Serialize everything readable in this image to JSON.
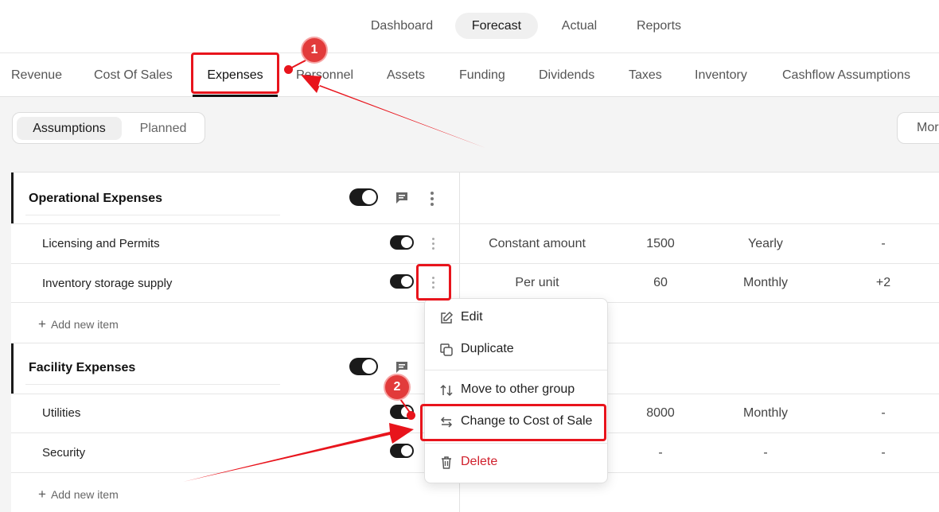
{
  "topnav": {
    "items": [
      {
        "label": "Dashboard"
      },
      {
        "label": "Forecast"
      },
      {
        "label": "Actual"
      },
      {
        "label": "Reports"
      }
    ],
    "active": "Forecast"
  },
  "subtabs": {
    "items": [
      {
        "label": "Revenue"
      },
      {
        "label": "Cost Of Sales"
      },
      {
        "label": "Expenses"
      },
      {
        "label": "Personnel"
      },
      {
        "label": "Assets"
      },
      {
        "label": "Funding"
      },
      {
        "label": "Dividends"
      },
      {
        "label": "Taxes"
      },
      {
        "label": "Inventory"
      },
      {
        "label": "Cashflow Assumptions"
      }
    ],
    "active": "Expenses"
  },
  "segment": {
    "assumptions": "Assumptions",
    "planned": "Planned",
    "more": "Mor"
  },
  "groups": [
    {
      "title": "Operational Expenses",
      "enabled": true,
      "rows": [
        {
          "label": "Licensing and Permits",
          "enabled": true,
          "method": "Constant amount",
          "amount": "1500",
          "frequency": "Yearly",
          "extra": "-"
        },
        {
          "label": "Inventory storage supply",
          "enabled": true,
          "method": "Per unit",
          "amount": "60",
          "frequency": "Monthly",
          "extra": "+2"
        }
      ],
      "add_label": "Add new item"
    },
    {
      "title": "Facility Expenses",
      "enabled": true,
      "rows": [
        {
          "label": "Utilities",
          "enabled": true,
          "method": "",
          "amount": "8000",
          "frequency": "Monthly",
          "extra": "-"
        },
        {
          "label": "Security",
          "enabled": true,
          "method": "",
          "amount": "-",
          "frequency": "-",
          "extra": "-"
        }
      ],
      "add_label": "Add new item"
    }
  ],
  "context_menu": {
    "items": [
      {
        "label": "Edit",
        "icon": "edit-icon"
      },
      {
        "label": "Duplicate",
        "icon": "duplicate-icon"
      },
      {
        "label": "Move to other group",
        "icon": "sort-arrows-icon"
      },
      {
        "label": "Change to Cost of Sale",
        "icon": "swap-arrows-icon"
      },
      {
        "label": "Delete",
        "icon": "trash-icon"
      }
    ]
  },
  "annotations": {
    "step1": "1",
    "step2": "2",
    "highlight_color": "#e8141c"
  },
  "colors": {
    "toggle_on": "#1a1a1a",
    "danger": "#d0202c",
    "background": "#f4f4f4"
  }
}
